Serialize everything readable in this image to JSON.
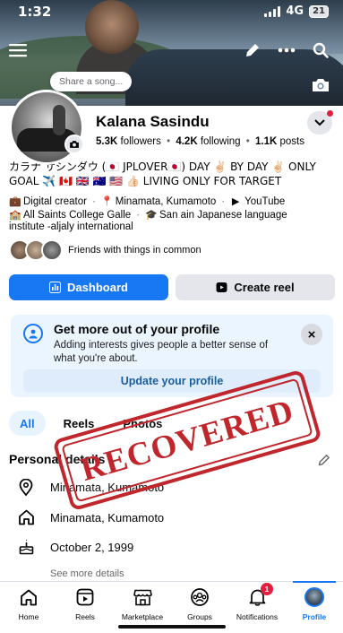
{
  "status_bar": {
    "time": "1:32",
    "network": "4G",
    "battery": "21"
  },
  "top_nav": {
    "menu_icon": "menu-icon",
    "edit_icon": "pencil-icon",
    "more_icon": "more-icon",
    "search_icon": "search-icon"
  },
  "cover": {
    "song_placeholder": "Share a song...",
    "camera_icon": "camera-icon"
  },
  "profile": {
    "name": "Kalana Sasindu",
    "followers_count": "5.3K",
    "followers_label": "followers",
    "following_count": "4.2K",
    "following_label": "following",
    "posts_count": "1.1K",
    "posts_label": "posts",
    "bio": "カラナ サシンダウ (🇯🇵 JPLOVER🇯🇵) DAY ✌🏻 BY DAY ✌🏻 ONLY GOAL ✈️ 🇨🇦 🇬🇧 🇦🇺 🇺🇸 👍🏻 LIVING ONLY FOR TARGET",
    "details_line1": {
      "role": "Digital creator",
      "location": "Minamata, Kumamoto",
      "link": "YouTube"
    },
    "details_line2": {
      "school": "All Saints College Galle",
      "education": "San ain Japanese language"
    },
    "details_line3": "institute -aljaly international",
    "friends_text": "Friends with things in common"
  },
  "actions": {
    "dashboard": "Dashboard",
    "create_reel": "Create reel"
  },
  "card": {
    "title": "Get more out of your profile",
    "text": "Adding interests gives people a better sense of what you're about.",
    "update_button": "Update your profile",
    "close": "×"
  },
  "tabs": [
    {
      "label": "All",
      "active": true
    },
    {
      "label": "Reels",
      "active": false
    },
    {
      "label": "Photos",
      "active": false
    }
  ],
  "personal": {
    "section_title": "Personal details",
    "rows": [
      {
        "icon": "location-pin-icon",
        "text": "Minamata, Kumamoto"
      },
      {
        "icon": "home-icon",
        "text": "Minamata, Kumamoto"
      },
      {
        "icon": "birthday-cake-icon",
        "text": "October 2, 1999"
      }
    ],
    "see_more": "See more details"
  },
  "stamp": {
    "text": "RECOVERED",
    "color": "#c0272d"
  },
  "bottom_nav": [
    {
      "label": "Home",
      "icon": "home-icon",
      "active": false
    },
    {
      "label": "Reels",
      "icon": "reels-icon",
      "active": false
    },
    {
      "label": "Marketplace",
      "icon": "marketplace-icon",
      "active": false
    },
    {
      "label": "Groups",
      "icon": "groups-icon",
      "active": false
    },
    {
      "label": "Notifications",
      "icon": "bell-icon",
      "active": false,
      "badge": "1"
    },
    {
      "label": "Profile",
      "icon": "profile-avatar",
      "active": true
    }
  ],
  "colors": {
    "accent": "#1877f2",
    "badge": "#e41e3f",
    "card_bg": "#ebf5ff"
  }
}
